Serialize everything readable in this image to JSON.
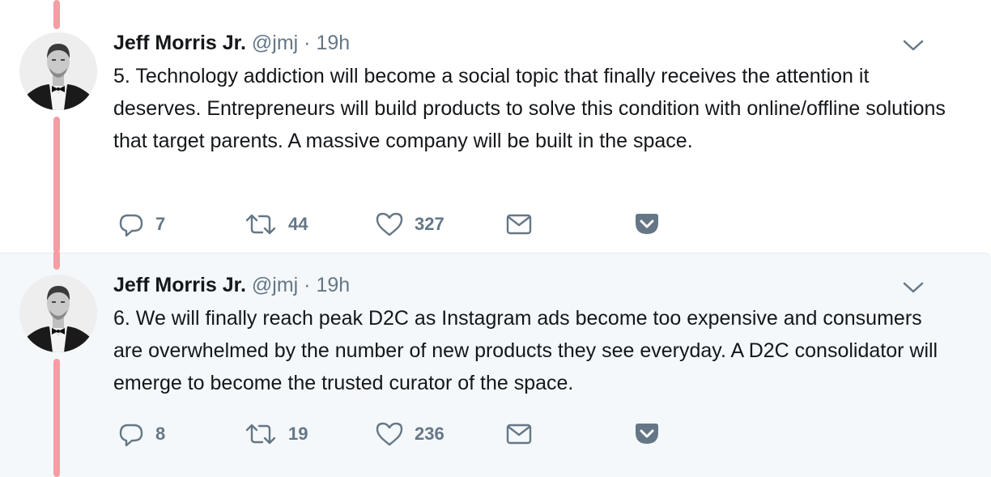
{
  "tweets": [
    {
      "author_name": "Jeff Morris Jr.",
      "handle": "@jmj",
      "separator": "·",
      "time": "19h",
      "text": "5. Technology addiction will become a social topic that finally receives the attention it deserves. Entrepreneurs will build products to solve this condition with online/offline solutions that target parents. A massive company will be built in the space.",
      "replies": "7",
      "retweets": "44",
      "likes": "327"
    },
    {
      "author_name": "Jeff Morris Jr.",
      "handle": "@jmj",
      "separator": "·",
      "time": "19h",
      "text": "6. We will finally reach peak D2C as Instagram ads become too expensive and consumers are overwhelmed by the number of new products they see everyday. A D2C consolidator will emerge to become the trusted curator of the space.",
      "replies": "8",
      "retweets": "19",
      "likes": "236"
    }
  ],
  "colors": {
    "thread_line": "#f49da3",
    "meta_gray": "#657786",
    "text": "#14171a",
    "highlight_bg": "#f5f8fa"
  },
  "icons": [
    "chevron-down-icon",
    "reply-icon",
    "retweet-icon",
    "like-icon",
    "message-icon",
    "pocket-icon"
  ]
}
